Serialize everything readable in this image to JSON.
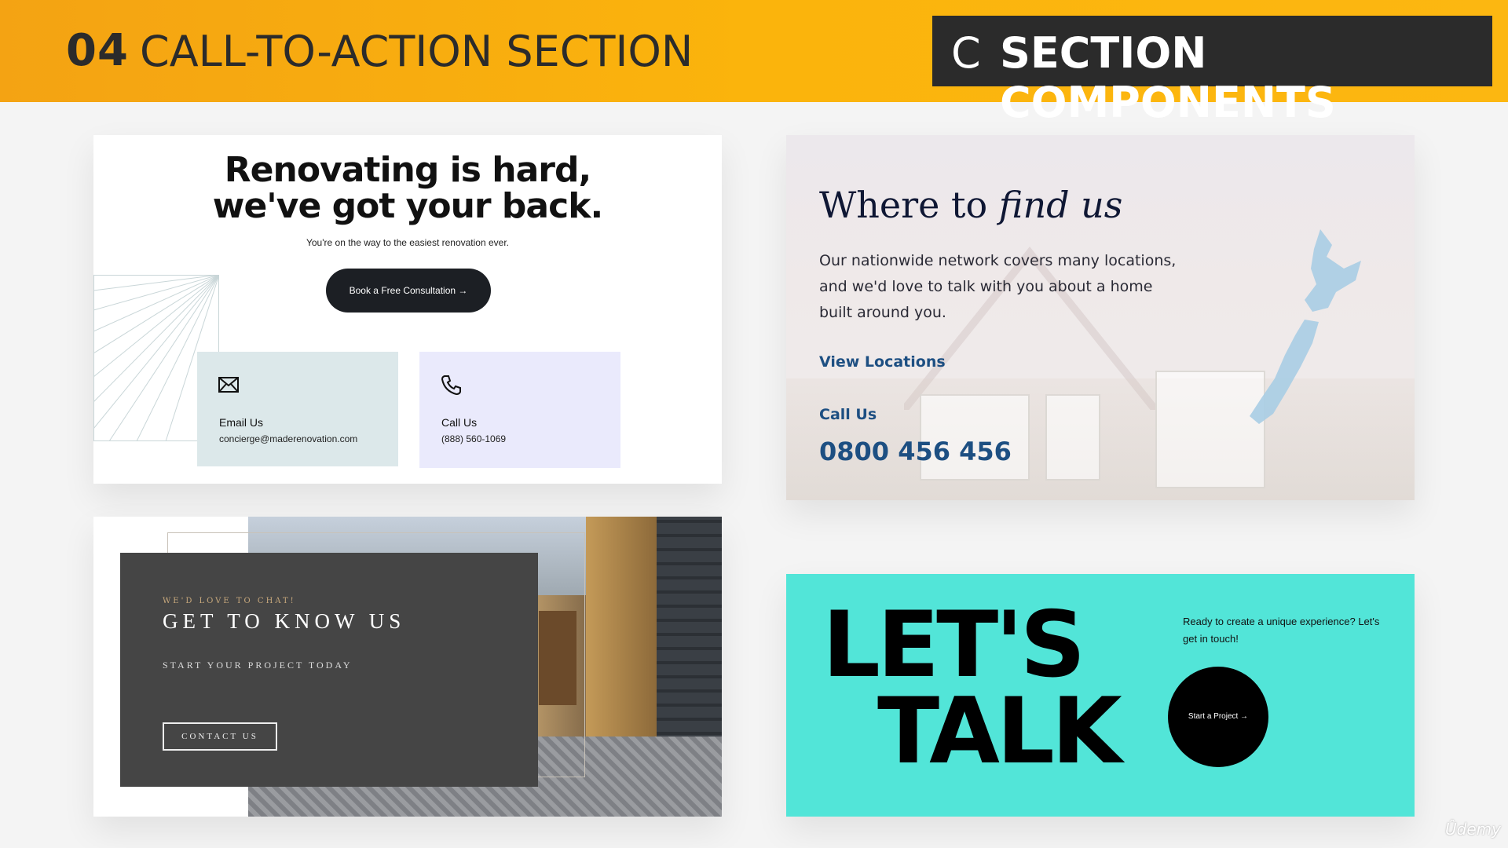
{
  "header": {
    "number": "04",
    "title": "CALL-TO-ACTION SECTION",
    "badge_letter": "C",
    "badge_label": "SECTION COMPONENTS",
    "bar_color": "#fbb40c",
    "badge_color": "#2b2b2b"
  },
  "card1": {
    "heading_line1": "Renovating is hard,",
    "heading_line2": "we've got your back.",
    "subtitle": "You're on the way to the easiest renovation ever.",
    "cta_label": "Book a Free Consultation →",
    "email": {
      "icon": "mail-icon",
      "label": "Email Us",
      "value": "concierge@maderenovation.com"
    },
    "phone": {
      "icon": "phone-icon",
      "label": "Call Us",
      "value": "(888) 560-1069"
    }
  },
  "card2": {
    "heading_plain": "Where to ",
    "heading_italic": "find us",
    "paragraph": "Our nationwide network covers many locations, and we'd love to talk with you about a home built around you.",
    "link": "View Locations",
    "call_label": "Call Us",
    "phone": "0800 456 456",
    "accent": "#1d4f82"
  },
  "card3": {
    "kicker": "WE'D LOVE TO CHAT!",
    "heading": "GET TO KNOW US",
    "subheading": "START YOUR PROJECT TODAY",
    "button": "CONTACT US"
  },
  "card4": {
    "line1": "LET'S",
    "line2": "TALK",
    "question": "Ready to create a unique experience? Let's get in touch!",
    "cta": "Start a Project →",
    "background": "#52e5d8"
  },
  "watermark": "Ûdemy"
}
